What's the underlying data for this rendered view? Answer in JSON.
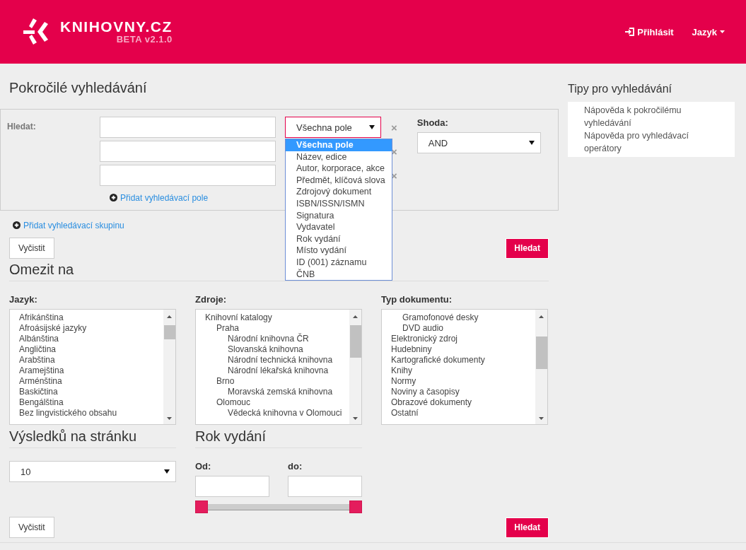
{
  "header": {
    "logo_text": "KNIHOVNY.CZ",
    "version": "BETA v2.1.0",
    "login": "Přihlásit",
    "language": "Jazyk"
  },
  "title": "Pokročilé vyhledávání",
  "search": {
    "label": "Hledat:",
    "rows": [
      {
        "remove": "×"
      },
      {
        "remove": "×"
      },
      {
        "remove": "×"
      }
    ],
    "field_select": {
      "value": "Všechna pole",
      "options": [
        {
          "label": "Všechna pole",
          "selected": true
        },
        {
          "label": "Název, edice",
          "selected": false
        },
        {
          "label": "Autor, korporace, akce",
          "selected": false
        },
        {
          "label": "Předmět, klíčová slova",
          "selected": false
        },
        {
          "label": "Zdrojový dokument",
          "selected": false
        },
        {
          "label": "ISBN/ISSN/ISMN",
          "selected": false
        },
        {
          "label": "Signatura",
          "selected": false
        },
        {
          "label": "Vydavatel",
          "selected": false
        },
        {
          "label": "Rok vydání",
          "selected": false
        },
        {
          "label": "Místo vydání",
          "selected": false
        },
        {
          "label": "ID (001) záznamu",
          "selected": false
        },
        {
          "label": "ČNB",
          "selected": false
        }
      ]
    },
    "add_field": "Přidat vyhledávací pole",
    "match": {
      "label": "Shoda:",
      "value": "AND"
    }
  },
  "add_group": "Přidat vyhledávací skupinu",
  "top_actions": {
    "clear": "Vyčistit",
    "submit": "Hledat"
  },
  "limit": {
    "heading": "Omezit na",
    "lists": [
      {
        "label": "Jazyk:",
        "items": [
          {
            "label": "Afrikánština"
          },
          {
            "label": "Afroásijské jazyky"
          },
          {
            "label": "Albánština"
          },
          {
            "label": "Angličtina"
          },
          {
            "label": "Arabština"
          },
          {
            "label": "Aramejština"
          },
          {
            "label": "Arménština"
          },
          {
            "label": "Baskičtina"
          },
          {
            "label": "Bengálština"
          },
          {
            "label": "Bez lingvistického obsahu"
          }
        ]
      },
      {
        "label": "Zdroje:",
        "items": [
          {
            "label": "Knihovní katalogy",
            "children": [
              {
                "label": "Praha",
                "children": [
                  {
                    "label": "Národní knihovna ČR"
                  },
                  {
                    "label": "Slovanská knihovna"
                  },
                  {
                    "label": "Národní technická knihovna"
                  },
                  {
                    "label": "Národní lékařská knihovna"
                  }
                ]
              },
              {
                "label": "Brno",
                "children": [
                  {
                    "label": "Moravská zemská knihovna"
                  }
                ]
              },
              {
                "label": "Olomouc",
                "children": [
                  {
                    "label": "Vědecká knihovna v Olomouci"
                  }
                ]
              }
            ]
          }
        ]
      },
      {
        "label": "Typ dokumentu:",
        "items": [
          {
            "children": [
              {
                "label": "Gramofonové desky"
              },
              {
                "label": "DVD audio"
              }
            ]
          },
          {
            "label": "Elektronický zdroj"
          },
          {
            "label": "Hudebniny"
          },
          {
            "label": "Kartografické dokumenty"
          },
          {
            "label": "Knihy"
          },
          {
            "label": "Normy"
          },
          {
            "label": "Noviny a časopisy"
          },
          {
            "label": "Obrazové dokumenty"
          },
          {
            "label": "Ostatní"
          }
        ]
      }
    ]
  },
  "per_page": {
    "heading": "Výsledků na stránku",
    "value": "10"
  },
  "year": {
    "heading": "Rok vydání",
    "from_label": "Od:",
    "to_label": "do:",
    "slider": {
      "start": {
        "level": 0
      },
      "end": {
        "level": 1
      }
    }
  },
  "bottom_actions": {
    "clear": "Vyčistit",
    "submit": "Hledat"
  },
  "tips": {
    "heading": "Tipy pro vyhledávání",
    "links": [
      "Nápověda k pokročilému vyhledávání",
      "Nápověda pro vyhledávací operátory"
    ]
  }
}
